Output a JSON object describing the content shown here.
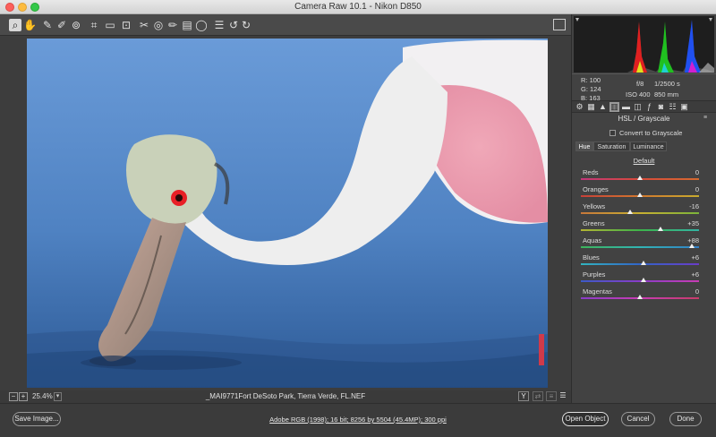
{
  "window": {
    "title": "Camera Raw 10.1  -  Nikon D850"
  },
  "toolbar": {
    "tools": [
      {
        "name": "zoom-tool-icon",
        "glyph": "⌕"
      },
      {
        "name": "hand-tool-icon",
        "glyph": "✋"
      },
      {
        "name": "white-balance-tool-icon",
        "glyph": "✎"
      },
      {
        "name": "color-sampler-tool-icon",
        "glyph": "✐"
      },
      {
        "name": "targeted-adjustment-tool-icon",
        "glyph": "⊚"
      },
      {
        "name": "crop-tool-icon",
        "glyph": "⌗"
      },
      {
        "name": "straighten-tool-icon",
        "glyph": "▭"
      },
      {
        "name": "transform-tool-icon",
        "glyph": "⊡"
      },
      {
        "name": "spot-removal-tool-icon",
        "glyph": "✂"
      },
      {
        "name": "red-eye-tool-icon",
        "glyph": "◎"
      },
      {
        "name": "adjustment-brush-icon",
        "glyph": "✏"
      },
      {
        "name": "graduated-filter-icon",
        "glyph": "▤"
      },
      {
        "name": "radial-filter-icon",
        "glyph": "◯"
      },
      {
        "name": "preferences-icon",
        "glyph": "☰"
      },
      {
        "name": "rotate-left-icon",
        "glyph": "↺"
      },
      {
        "name": "rotate-right-icon",
        "glyph": "↻"
      }
    ]
  },
  "readout": {
    "r": "R:   100",
    "g": "G:   124",
    "b": "B:   163",
    "aperture": "f/8",
    "shutter": "1/2500 s",
    "iso": "ISO 400",
    "focal": "850 mm"
  },
  "panel": {
    "title": "HSL / Grayscale",
    "convert_label": "Convert to Grayscale",
    "subtabs": [
      "Hue",
      "Saturation",
      "Luminance"
    ],
    "default_link": "Default",
    "sliders": [
      {
        "label": "Reds",
        "value": "0",
        "pos": 0.5,
        "gradient": "linear-gradient(90deg,#c2367a,#d84a3a,#d46a30)"
      },
      {
        "label": "Oranges",
        "value": "0",
        "pos": 0.5,
        "gradient": "linear-gradient(90deg,#c84038,#d2782e,#c8ab2e)"
      },
      {
        "label": "Yellows",
        "value": "-16",
        "pos": 0.42,
        "gradient": "linear-gradient(90deg,#c8783a,#c8b032,#7cb43a)"
      },
      {
        "label": "Greens",
        "value": "+35",
        "pos": 0.675,
        "gradient": "linear-gradient(90deg,#b4b432,#3cb44a,#32b4a4)"
      },
      {
        "label": "Aquas",
        "value": "+88",
        "pos": 0.94,
        "gradient": "linear-gradient(90deg,#3cb45a,#32b4b4,#3280c8)"
      },
      {
        "label": "Blues",
        "value": "+6",
        "pos": 0.53,
        "gradient": "linear-gradient(90deg,#32b4c0,#3264c8,#6a3cc8)"
      },
      {
        "label": "Purples",
        "value": "+6",
        "pos": 0.53,
        "gradient": "linear-gradient(90deg,#3c5ac8,#8a3cc8,#c83cb4)"
      },
      {
        "label": "Magentas",
        "value": "0",
        "pos": 0.5,
        "gradient": "linear-gradient(90deg,#8a3cc8,#c83cb4,#c83c6a)"
      }
    ]
  },
  "status": {
    "zoom_level": "25.4%",
    "filename": "_MAI9771Fort DeSoto Park, Tierra Verde, FL.NEF",
    "view_label": "Y"
  },
  "bottom": {
    "save_label": "Save Image...",
    "workflow_link": "Adobe RGB (1998); 16 bit; 8256 by 5504 (45.4MP); 300 ppi",
    "open_label": "Open Object",
    "cancel_label": "Cancel",
    "done_label": "Done"
  }
}
